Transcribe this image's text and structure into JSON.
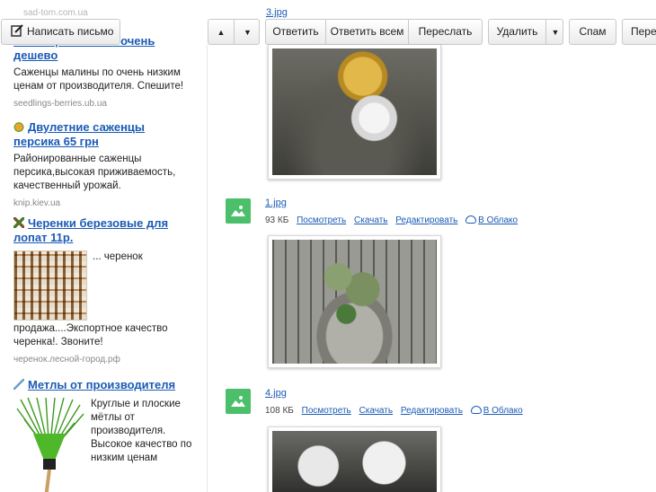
{
  "left_ads": {
    "top_url": "sad-tom.com.ua",
    "ads": [
      {
        "title": "Саженцы малины очень дешево",
        "body": "Саженцы малины по очень низким ценам от производителя. Спешите!",
        "url": "seedlings-berries.ub.ua"
      },
      {
        "title": "Двулетние саженцы персика 65 грн",
        "body": "Районированные саженцы персика,высокая приживаемость, качественный урожай.",
        "url": "knip.kiev.ua",
        "icon": "peach-icon"
      },
      {
        "title": "Черенки березовые для лопат 11р.",
        "body_top": "... черенок",
        "body": "продажа....Экспортное качество черенка!. Звоните!",
        "url": "черенок.лесной-город.рф",
        "icon": "tree-icon"
      },
      {
        "title": "Метлы от производителя",
        "body": "Круглые и плоские мётлы от производителя. Высокое качество по низким ценам",
        "icon": "broom-icon"
      }
    ]
  },
  "toolbar": {
    "compose": "Написать письмо",
    "up_icon": "triangle-up",
    "down_icon": "triangle-down",
    "reply": "Ответить",
    "reply_all": "Ответить всем",
    "forward": "Переслать",
    "delete": "Удалить",
    "spam": "Спам",
    "move": "Пере"
  },
  "attachments": {
    "top_partial_name": "3.jpg",
    "items": [
      {
        "name": "1.jpg",
        "size": "93 КБ",
        "view": "Посмотреть",
        "download": "Скачать",
        "edit": "Редактировать",
        "cloud": "В Облако"
      },
      {
        "name": "4.jpg",
        "size": "108 КБ",
        "view": "Посмотреть",
        "download": "Скачать",
        "edit": "Редактировать",
        "cloud": "В Облако"
      }
    ]
  },
  "colors": {
    "link": "#1a5bb5",
    "attachment_icon": "#4bbf6a"
  }
}
